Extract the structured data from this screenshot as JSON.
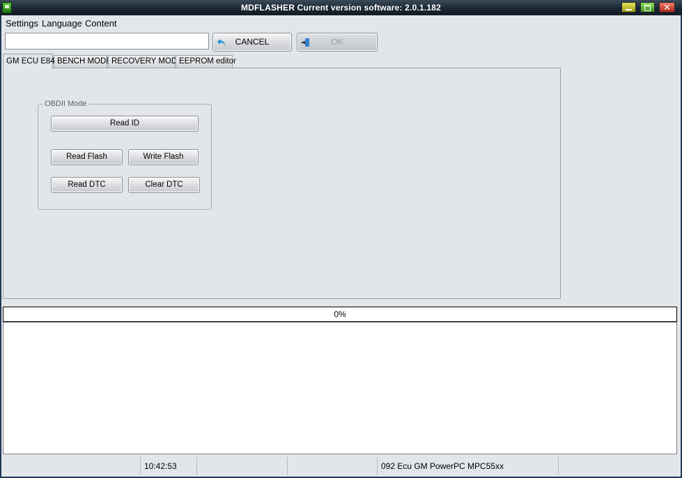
{
  "window": {
    "title": "MDFLASHER  Current version software: 2.0.1.182",
    "controls": {
      "minimize_icon": "minimize-icon",
      "maximize_icon": "maximize-icon",
      "close_icon": "close-icon",
      "close_glyph": "✕"
    }
  },
  "menu": [
    {
      "label": "Settings"
    },
    {
      "label": "Language"
    },
    {
      "label": "Content"
    }
  ],
  "toolbar": {
    "input_value": "",
    "cancel_label": "CANCEL",
    "cancel_icon": "undo-arrow-icon",
    "ok_label": "OK",
    "ok_icon": "exit-door-icon",
    "ok_enabled": false
  },
  "tabs": [
    {
      "label": "GM ECU E84",
      "active": true
    },
    {
      "label": "BENCH MODE",
      "active": false
    },
    {
      "label": "RECOVERY MODE",
      "active": false
    },
    {
      "label": "EEPROM editor",
      "active": false
    }
  ],
  "obdii_group": {
    "title": "OBDII Mode",
    "read_id": "Read ID",
    "read_flash": "Read Flash",
    "write_flash": "Write Flash",
    "read_dtc": "Read DTC",
    "clear_dtc": "Clear DTC"
  },
  "progress": {
    "text": "0%",
    "value": 0
  },
  "log": {
    "lines": []
  },
  "status": {
    "cells": [
      "",
      "10:42:53",
      "",
      "",
      "092 Ecu GM PowerPC MPC55xx",
      ""
    ]
  },
  "colors": {
    "client_background": "#e3e6e9",
    "title_text": "#ffffff",
    "accent_cancel_arrow": "#1e90d8"
  }
}
